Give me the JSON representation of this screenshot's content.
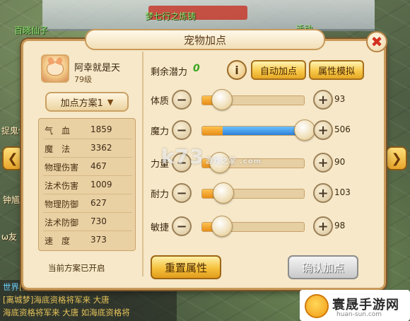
{
  "dialog": {
    "title": "宠物加点",
    "close_icon": "close-icon",
    "close_glyph": "✖"
  },
  "pet": {
    "name": "阿幸就是天",
    "level": "79级",
    "avatar_icon": "pet-avatar-icon"
  },
  "scheme": {
    "label": "加点方案1",
    "note": "当前方案已开启"
  },
  "stats": [
    {
      "label": "气　血",
      "value": "1859"
    },
    {
      "label": "魔　法",
      "value": "3362"
    },
    {
      "label": "物理伤害",
      "value": "467"
    },
    {
      "label": "法术伤害",
      "value": "1009"
    },
    {
      "label": "物理防御",
      "value": "627"
    },
    {
      "label": "法术防御",
      "value": "730"
    },
    {
      "label": "速　度",
      "value": "373"
    }
  ],
  "potential": {
    "label": "剩余潜力",
    "value": "0"
  },
  "buttons": {
    "info": "i",
    "auto": "自动加点",
    "simulate": "属性模拟",
    "reset": "重置属性",
    "confirm": "确认加点",
    "minus": "−",
    "plus": "+"
  },
  "attributes": [
    {
      "label": "体质",
      "value": "93",
      "base_fraction": 0.2,
      "added_fraction": 0.0
    },
    {
      "label": "魔力",
      "value": "506",
      "base_fraction": 0.2,
      "added_fraction": 0.8
    },
    {
      "label": "力量",
      "value": "90",
      "base_fraction": 0.18,
      "added_fraction": 0.0
    },
    {
      "label": "耐力",
      "value": "103",
      "base_fraction": 0.21,
      "added_fraction": 0.0
    },
    {
      "label": "敏捷",
      "value": "98",
      "base_fraction": 0.2,
      "added_fraction": 0.0
    }
  ],
  "background": {
    "npc_labels": [
      "梦七行之炼铸",
      "百晓仙子",
      "活动",
      "捉鬼任",
      "钟馗",
      "ω友"
    ],
    "chat": [
      {
        "channel": "世界",
        "text": "[安"
      },
      {
        "channel": "",
        "text": "[离城梦]海底资格将军来 大唐"
      },
      {
        "channel": "",
        "text": "海底资格将军来 大唐 如海底资格将"
      }
    ],
    "left_arrow": "❮",
    "right_arrow": "❯"
  },
  "watermark": {
    "text": "k73",
    "sub": "游戏之家 .com"
  },
  "site": {
    "name": "寰晟手游网",
    "url": "huan-sun.com"
  },
  "colors": {
    "panel": "#f6e8c8",
    "border": "#c99a5a",
    "gold_button": "#f8c94a",
    "potential_green": "#3aa61f",
    "slider_orange": "#e78d16",
    "slider_blue": "#2a7fd6",
    "close_red": "#d23020"
  }
}
